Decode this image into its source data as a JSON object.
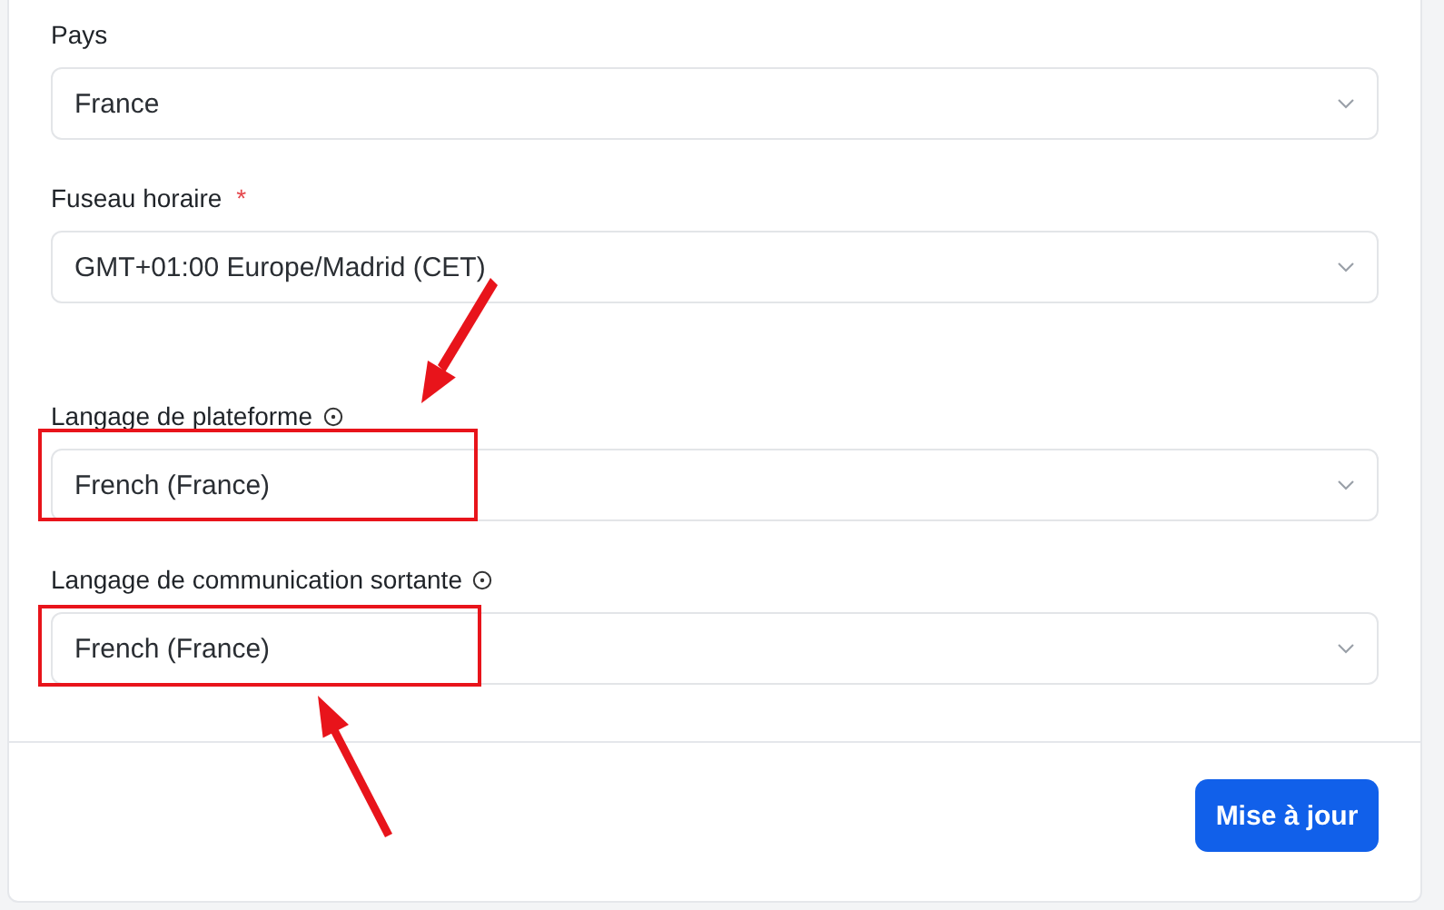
{
  "fields": [
    {
      "label": "Pays",
      "info": false,
      "value": "France"
    },
    {
      "label": "Fuseau horaire",
      "required_mark": "*",
      "info": false,
      "value": "GMT+01:00 Europe/Madrid (CET)"
    },
    {
      "label": "Langage de plateforme",
      "info": true,
      "value": "French (France)"
    },
    {
      "label": "Langage de communication sortante",
      "info": true,
      "value": "French (France)"
    }
  ],
  "submit_button": "Mise à jour"
}
